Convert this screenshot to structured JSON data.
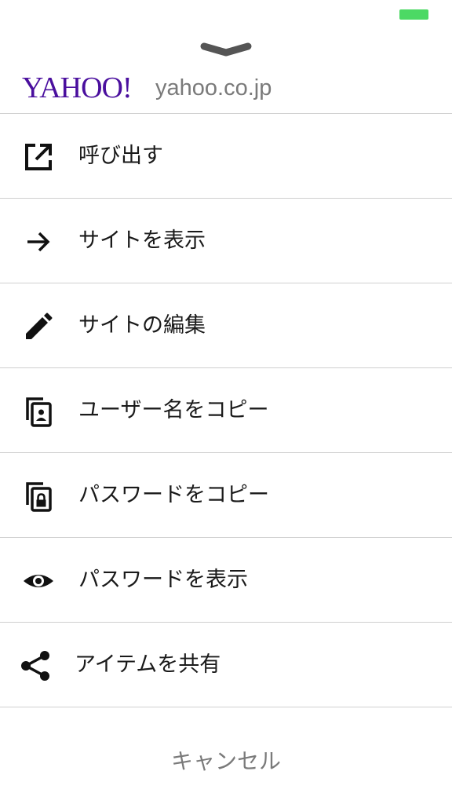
{
  "status_bar": {
    "battery_color": "#4cd964"
  },
  "header": {
    "logo": "YAHOO!",
    "logo_color": "#4a0f9e",
    "domain": "yahoo.co.jp"
  },
  "menu": {
    "items": [
      {
        "label": "呼び出す",
        "icon": "open-in-new-icon"
      },
      {
        "label": "サイトを表示",
        "icon": "arrow-right-icon"
      },
      {
        "label": "サイトの編集",
        "icon": "pencil-icon"
      },
      {
        "label": "ユーザー名をコピー",
        "icon": "copy-username-icon"
      },
      {
        "label": "パスワードをコピー",
        "icon": "copy-password-icon"
      },
      {
        "label": "パスワードを表示",
        "icon": "eye-icon"
      },
      {
        "label": "アイテムを共有",
        "icon": "share-icon"
      }
    ]
  },
  "cancel_label": "キャンセル"
}
